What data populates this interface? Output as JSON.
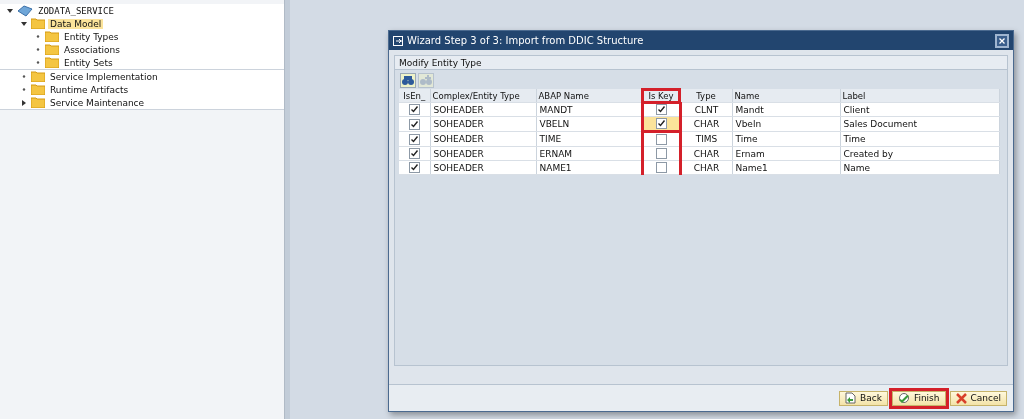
{
  "tree": [
    {
      "label": "ZODATA_SERVICE",
      "expanded": true,
      "selected": false,
      "children": [
        {
          "label": "Data Model",
          "expanded": true,
          "selected": true,
          "children": [
            {
              "label": "Entity Types",
              "selected": false
            },
            {
              "label": "Associations",
              "selected": false
            },
            {
              "label": "Entity Sets",
              "selected": false
            }
          ]
        },
        {
          "label": "Service Implementation",
          "selected": false
        },
        {
          "label": "Runtime Artifacts",
          "selected": false
        },
        {
          "label": "Service Maintenance",
          "expanded": false,
          "selected": false
        }
      ]
    }
  ],
  "dialog": {
    "title": "Wizard Step 3 of 3: Import from DDIC Structure",
    "group_title": "Modify Entity Type",
    "table": {
      "columns": [
        {
          "label": "IsEn_",
          "kind": "check",
          "highlighted": false
        },
        {
          "label": "Complex/Entity Type",
          "kind": "text",
          "highlighted": false
        },
        {
          "label": "ABAP Name",
          "kind": "text",
          "highlighted": false
        },
        {
          "label": "Is Key",
          "kind": "check",
          "highlighted": true
        },
        {
          "label": "Type",
          "kind": "center",
          "highlighted": false
        },
        {
          "label": "Name",
          "kind": "text",
          "highlighted": false
        },
        {
          "label": "Label",
          "kind": "text",
          "highlighted": false
        }
      ],
      "rows": [
        {
          "cells": [
            true,
            "SOHEADER",
            "MANDT",
            true,
            "CLNT",
            "Mandt",
            "Client"
          ],
          "key_focused": false
        },
        {
          "cells": [
            true,
            "SOHEADER",
            "VBELN",
            true,
            "CHAR",
            "Vbeln",
            "Sales Document"
          ],
          "key_focused": true
        },
        {
          "cells": [
            true,
            "SOHEADER",
            "TIME",
            false,
            "TIMS",
            "Time",
            "Time"
          ],
          "key_focused": false
        },
        {
          "cells": [
            true,
            "SOHEADER",
            "ERNAM",
            false,
            "CHAR",
            "Ernam",
            "Created by"
          ],
          "key_focused": false
        },
        {
          "cells": [
            true,
            "SOHEADER",
            "NAME1",
            false,
            "CHAR",
            "Name1",
            "Name"
          ],
          "key_focused": false
        }
      ]
    },
    "buttons": [
      {
        "label": "Back",
        "highlighted": false
      },
      {
        "label": "Finish",
        "highlighted": true
      },
      {
        "label": "Cancel",
        "highlighted": false
      }
    ]
  }
}
